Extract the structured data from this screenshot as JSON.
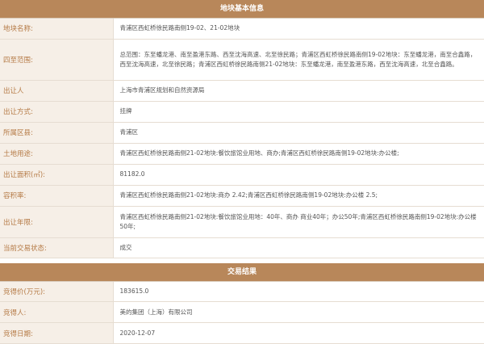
{
  "section1": {
    "title": "地块基本信息",
    "rows": [
      {
        "label": "地块名称:",
        "value": "青浦区西虹桥徐民路南侧19-02、21-02地块"
      },
      {
        "label": "四至范围:",
        "value": "总范围：东至蟠龙港、南至盈港东路、西至沈海高速、北至徐民路；青浦区西虹桥徐民路南侧19-02地块：东至蟠龙港，南至合鑫路，西至沈海高速，北至徐民路；青浦区西虹桥徐民路南侧21-02地块：东至蟠龙港，南至盈港东路，西至沈海高速，北至合鑫路。"
      },
      {
        "label": "出让人",
        "value": "上海市青浦区规划和自然资源局"
      },
      {
        "label": "出让方式:",
        "value": "挂牌"
      },
      {
        "label": "所属区县:",
        "value": "青浦区"
      },
      {
        "label": "土地用途:",
        "value": "青浦区西虹桥徐民路南侧21-02地块:餐饮旅馆业用地、商办;青浦区西虹桥徐民路南侧19-02地块:办公楼;"
      },
      {
        "label": "出让面积(㎡):",
        "value": "81182.0"
      },
      {
        "label": "容积率:",
        "value": "青浦区西虹桥徐民路南侧21-02地块:商办 2.42;青浦区西虹桥徐民路南侧19-02地块:办公楼 2.5;"
      },
      {
        "label": "出让年限:",
        "value": "青浦区西虹桥徐民路南侧21-02地块:餐饮旅馆业用地：40年、商办 商业40年；办公50年;青浦区西虹桥徐民路南侧19-02地块:办公楼 50年;"
      },
      {
        "label": "当前交易状态:",
        "value": "成交"
      }
    ]
  },
  "section2": {
    "title": "交易结果",
    "rows": [
      {
        "label": "竞得价(万元):",
        "value": "183615.0"
      },
      {
        "label": "竞得人:",
        "value": "美的集团（上海）有限公司"
      },
      {
        "label": "竞得日期:",
        "value": "2020-12-07"
      }
    ]
  }
}
